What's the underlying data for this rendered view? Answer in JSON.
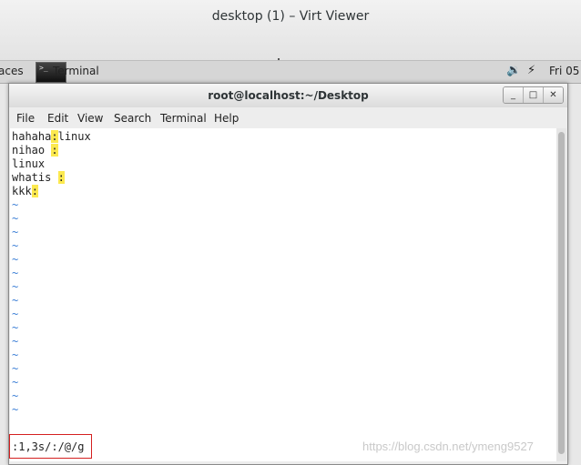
{
  "viewer": {
    "title": "desktop (1) – Virt Viewer"
  },
  "panel": {
    "workspaces": "aces",
    "terminal_thumb_text": ">_",
    "terminal_label": "Terminal",
    "clock": "Fri 05",
    "sound_icon": "🔉",
    "user_icon": "⚡"
  },
  "window": {
    "title": "root@localhost:~/Desktop",
    "buttons": {
      "minimize": "_",
      "maximize": "□",
      "close": "✕"
    },
    "menu": [
      "File",
      "Edit",
      "View",
      "Search",
      "Terminal",
      "Help"
    ]
  },
  "editor": {
    "lines": [
      {
        "before": "hahaha",
        "match": ":",
        "after": "linux"
      },
      {
        "before": "nihao ",
        "match": ":",
        "after": ""
      },
      {
        "before": "linux",
        "match": "",
        "after": ""
      },
      {
        "before": "whatis ",
        "match": ":",
        "after": ""
      },
      {
        "before": "kkk",
        "match": ":",
        "after": ""
      }
    ],
    "tilde": "~",
    "command": ":1,3s/:/@/g"
  },
  "watermark": "https://blog.csdn.net/ymeng9527"
}
